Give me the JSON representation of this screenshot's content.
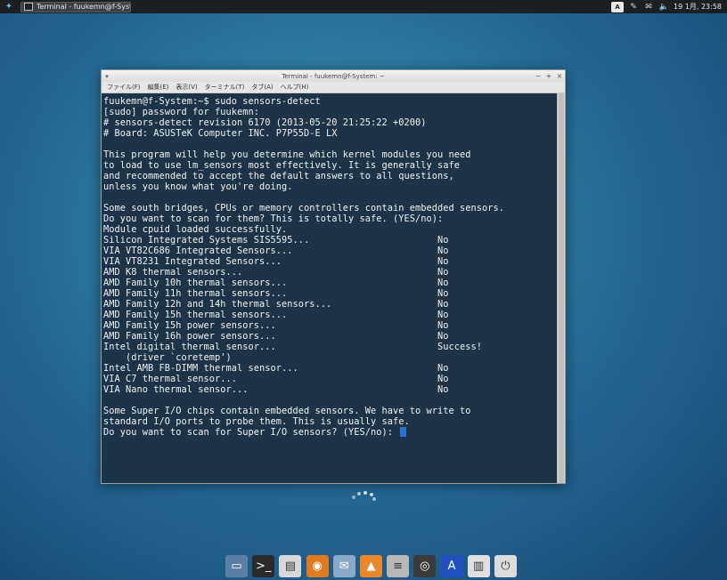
{
  "panel": {
    "task_title": "Terminal - fuukemn@f-System: ~",
    "keyboard_indicator": "A",
    "clock": "19 1月, 23:58"
  },
  "window": {
    "title": "Terminal - fuukemn@f-System: ~",
    "menu": [
      "ファイル(F)",
      "編集(E)",
      "表示(V)",
      "ターミナル(T)",
      "タブ(A)",
      "ヘルプ(H)"
    ]
  },
  "terminal": {
    "lines": [
      "fuukemn@f-System:~$ sudo sensors-detect",
      "[sudo] password for fuukemn:",
      "# sensors-detect revision 6170 (2013-05-20 21:25:22 +0200)",
      "# Board: ASUSTeK Computer INC. P7P55D-E LX",
      "",
      "This program will help you determine which kernel modules you need",
      "to load to use lm_sensors most effectively. It is generally safe",
      "and recommended to accept the default answers to all questions,",
      "unless you know what you're doing.",
      "",
      "Some south bridges, CPUs or memory controllers contain embedded sensors.",
      "Do you want to scan for them? This is totally safe. (YES/no):",
      "Module cpuid loaded successfully.",
      "Silicon Integrated Systems SIS5595...                       No",
      "VIA VT82C686 Integrated Sensors...                          No",
      "VIA VT8231 Integrated Sensors...                            No",
      "AMD K8 thermal sensors...                                   No",
      "AMD Family 10h thermal sensors...                           No",
      "AMD Family 11h thermal sensors...                           No",
      "AMD Family 12h and 14h thermal sensors...                   No",
      "AMD Family 15h thermal sensors...                           No",
      "AMD Family 15h power sensors...                             No",
      "AMD Family 16h power sensors...                             No",
      "Intel digital thermal sensor...                             Success!",
      "    (driver `coretemp')",
      "Intel AMB FB-DIMM thermal sensor...                         No",
      "VIA C7 thermal sensor...                                    No",
      "VIA Nano thermal sensor...                                  No",
      "",
      "Some Super I/O chips contain embedded sensors. We have to write to",
      "standard I/O ports to probe them. This is usually safe.",
      "Do you want to scan for Super I/O sensors? (YES/no): "
    ]
  },
  "dock": [
    {
      "name": "show-desktop-icon",
      "glyph": "▭",
      "bg": "#5c7fa8"
    },
    {
      "name": "terminal-icon",
      "glyph": ">_",
      "bg": "#2a2a2a"
    },
    {
      "name": "file-manager-icon",
      "glyph": "▤",
      "bg": "#d8d8d8"
    },
    {
      "name": "firefox-icon",
      "glyph": "◉",
      "bg": "#e07a1f"
    },
    {
      "name": "mail-client-icon",
      "glyph": "✉",
      "bg": "#8aa8c8"
    },
    {
      "name": "vlc-icon",
      "glyph": "▲",
      "bg": "#e8882a"
    },
    {
      "name": "audio-mixer-icon",
      "glyph": "≡",
      "bg": "#b8b8b8"
    },
    {
      "name": "disc-burner-icon",
      "glyph": "◎",
      "bg": "#3a3a3a"
    },
    {
      "name": "font-viewer-icon",
      "glyph": "A",
      "bg": "#2050c0"
    },
    {
      "name": "trash-icon",
      "glyph": "▥",
      "bg": "#e0e0e0"
    },
    {
      "name": "logout-icon",
      "glyph": "⏻",
      "bg": "#dcdcdc"
    }
  ]
}
